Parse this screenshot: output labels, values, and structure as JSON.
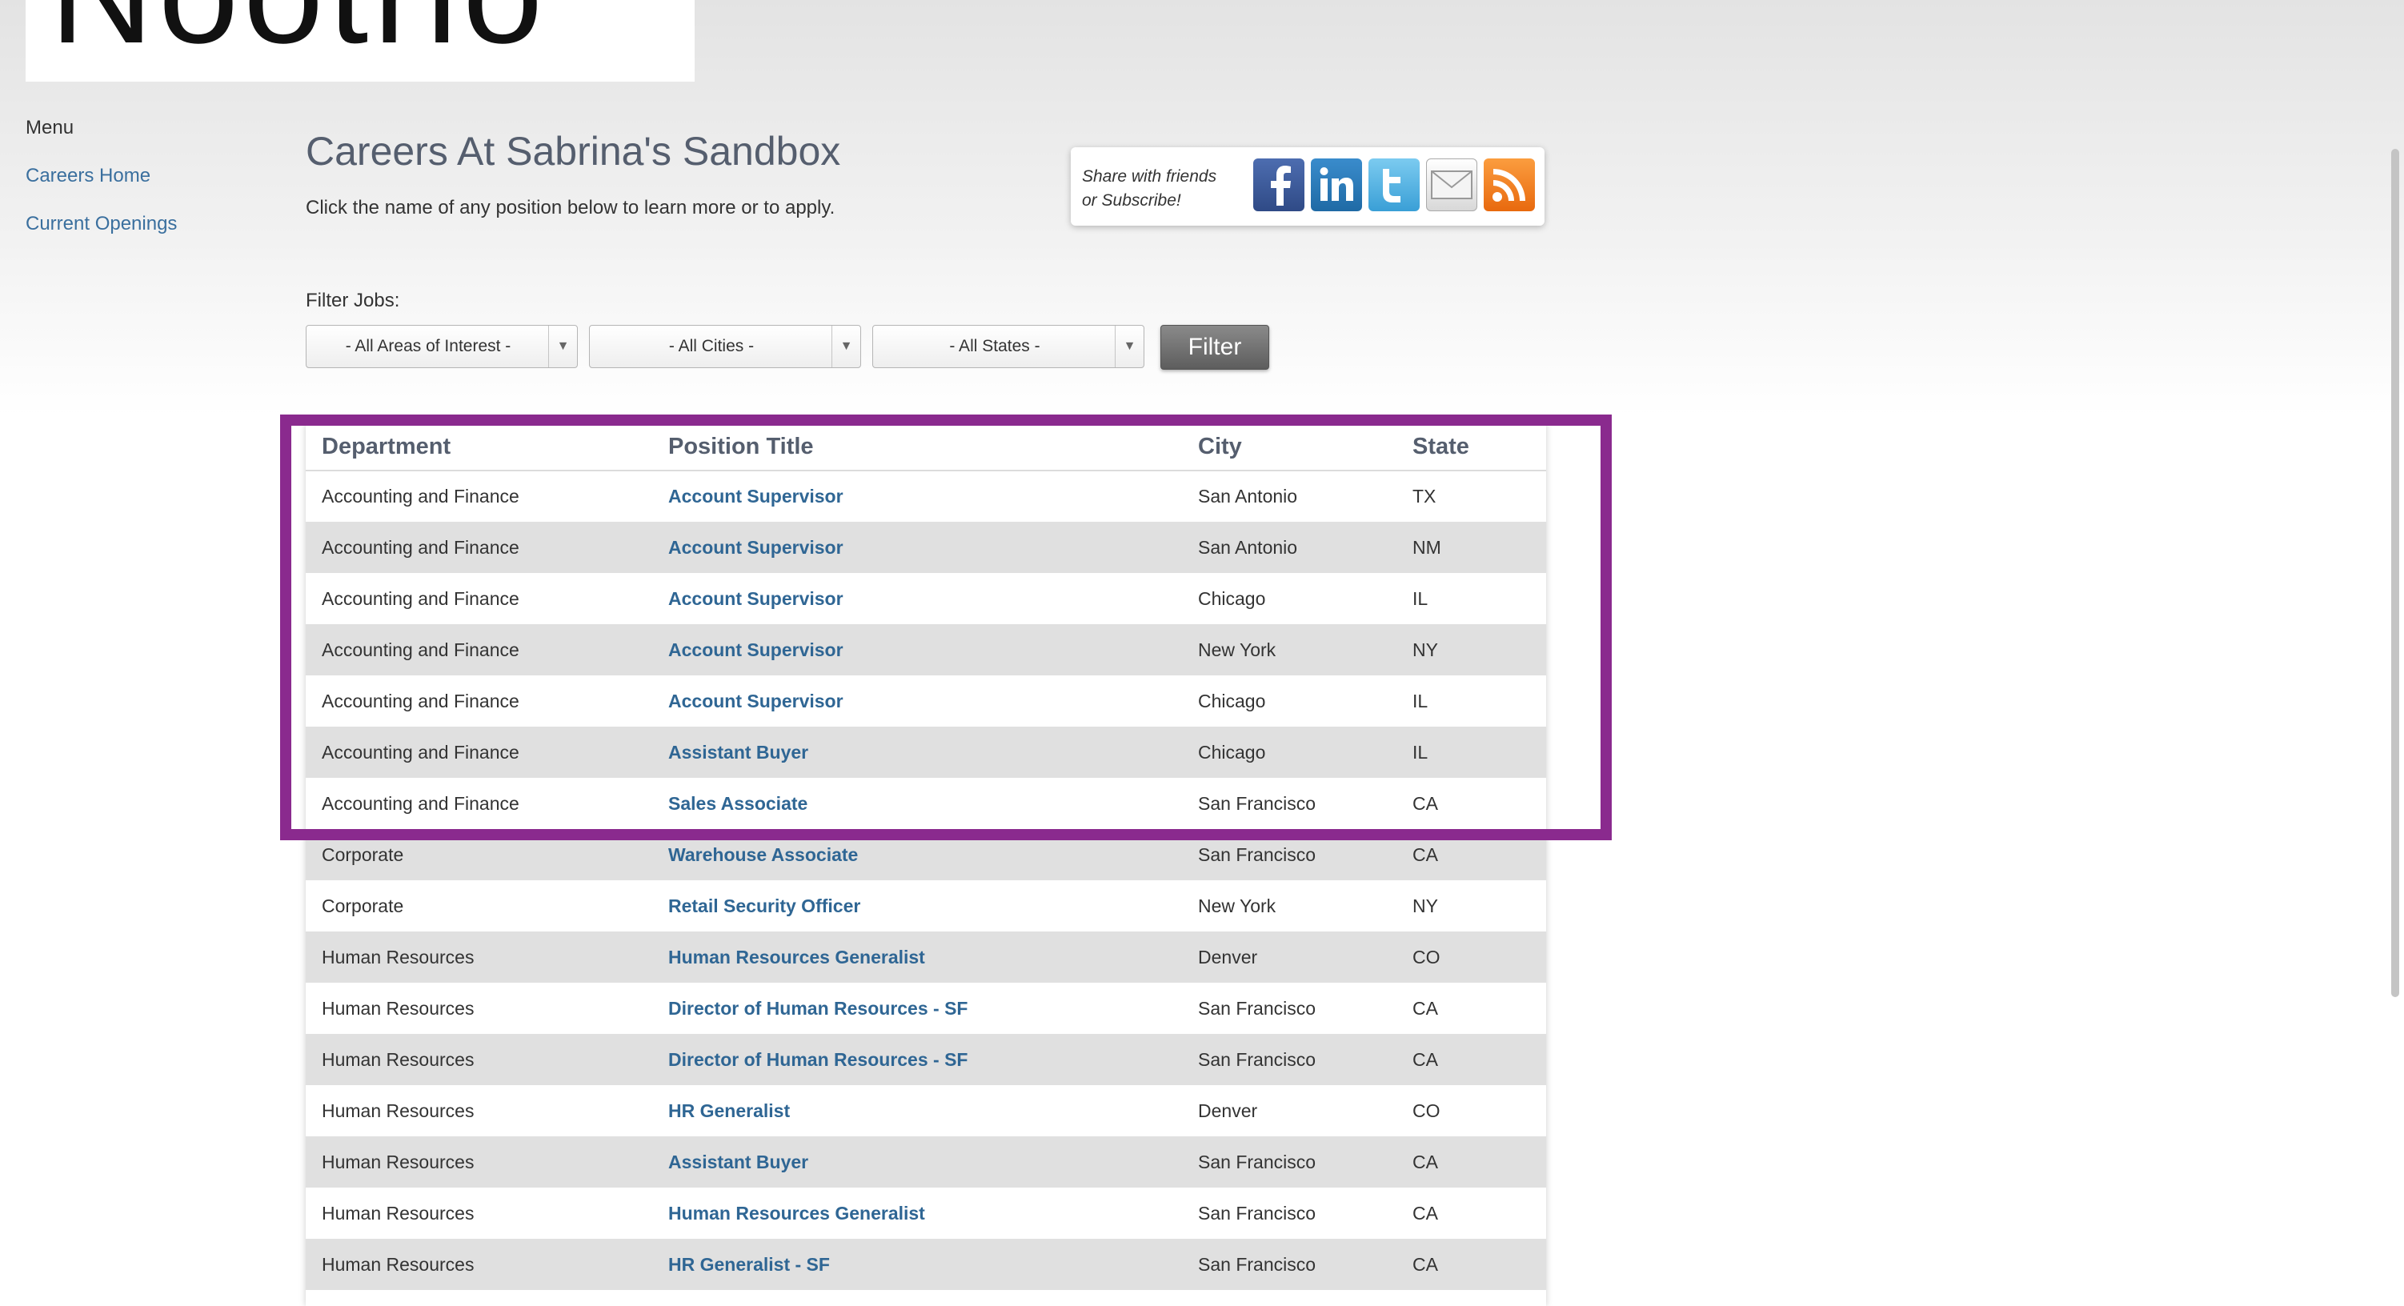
{
  "logo": {
    "text": "Nootrio"
  },
  "sidebar": {
    "menu_label": "Menu",
    "links": [
      "Careers Home",
      "Current Openings"
    ]
  },
  "header": {
    "title": "Careers At Sabrina's Sandbox",
    "subtitle": "Click the name of any position below to learn more or to apply."
  },
  "share": {
    "text_line1": "Share with friends",
    "text_line2": "or Subscribe!",
    "icons": [
      "facebook-icon",
      "linkedin-icon",
      "twitter-icon",
      "email-icon",
      "rss-icon"
    ]
  },
  "filters": {
    "label": "Filter Jobs:",
    "area": "- All Areas of Interest -",
    "city": "- All Cities -",
    "state": "- All States -",
    "button": "Filter"
  },
  "table": {
    "headers": [
      "Department",
      "Position Title",
      "City",
      "State"
    ],
    "rows": [
      [
        "Accounting and Finance",
        "Account Supervisor",
        "San Antonio",
        "TX"
      ],
      [
        "Accounting and Finance",
        "Account Supervisor",
        "San Antonio",
        "NM"
      ],
      [
        "Accounting and Finance",
        "Account Supervisor",
        "Chicago",
        "IL"
      ],
      [
        "Accounting and Finance",
        "Account Supervisor",
        "New York",
        "NY"
      ],
      [
        "Accounting and Finance",
        "Account Supervisor",
        "Chicago",
        "IL"
      ],
      [
        "Accounting and Finance",
        "Assistant Buyer",
        "Chicago",
        "IL"
      ],
      [
        "Accounting and Finance",
        "Sales Associate",
        "San Francisco",
        "CA"
      ],
      [
        "Corporate",
        "Warehouse Associate",
        "San Francisco",
        "CA"
      ],
      [
        "Corporate",
        "Retail Security Officer",
        "New York",
        "NY"
      ],
      [
        "Human Resources",
        "Human Resources Generalist",
        "Denver",
        "CO"
      ],
      [
        "Human Resources",
        "Director of Human Resources - SF",
        "San Francisco",
        "CA"
      ],
      [
        "Human Resources",
        "Director of Human Resources - SF",
        "San Francisco",
        "CA"
      ],
      [
        "Human Resources",
        "HR Generalist",
        "Denver",
        "CO"
      ],
      [
        "Human Resources",
        "Assistant Buyer",
        "San Francisco",
        "CA"
      ],
      [
        "Human Resources",
        "Human Resources Generalist",
        "San Francisco",
        "CA"
      ],
      [
        "Human Resources",
        "HR Generalist - SF",
        "San Francisco",
        "CA"
      ]
    ]
  },
  "colors": {
    "link": "#3a6f9e",
    "position_link": "#2f6694",
    "highlight": "#8a2a8e",
    "facebook": "#3b5998",
    "linkedin": "#2a7ab8",
    "twitter": "#4fb4e4",
    "rss": "#f58220"
  }
}
